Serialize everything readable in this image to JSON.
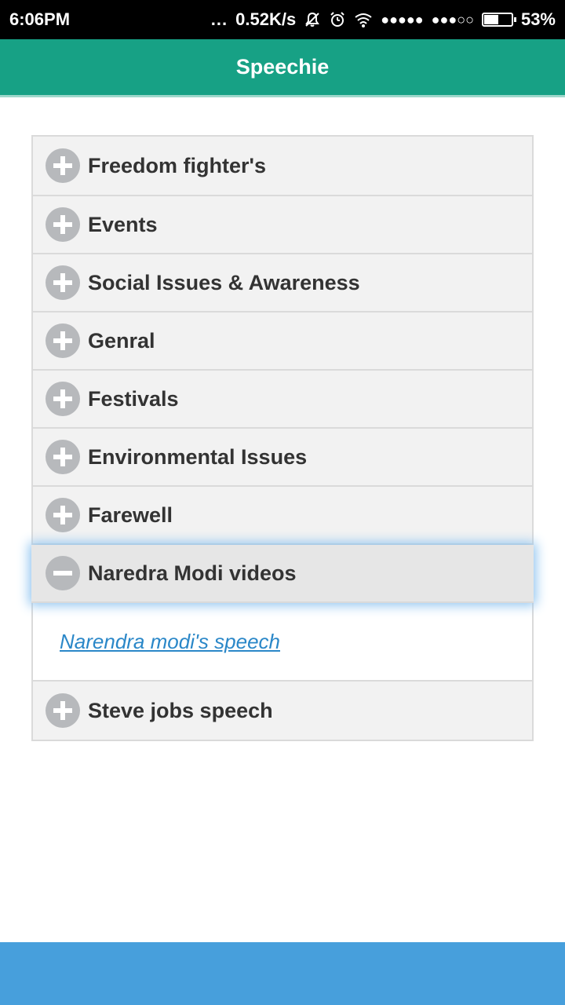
{
  "status_bar": {
    "time": "6:06PM",
    "more_dots": "...",
    "net_speed": "0.52K/s",
    "signal1": "●●●●●",
    "signal2": "●●●○○",
    "battery_percent": "53%",
    "battery_level": 0.53,
    "icons": [
      "mute-bell-icon",
      "alarm-icon",
      "wifi-icon"
    ]
  },
  "header": {
    "title": "Speechie",
    "color": "#17a185"
  },
  "accordion": {
    "items": [
      {
        "label": "Freedom fighter's",
        "expanded": false
      },
      {
        "label": "Events",
        "expanded": false
      },
      {
        "label": "Social Issues & Awareness",
        "expanded": false
      },
      {
        "label": "Genral",
        "expanded": false
      },
      {
        "label": "Festivals",
        "expanded": false
      },
      {
        "label": "Environmental Issues",
        "expanded": false
      },
      {
        "label": "Farewell",
        "expanded": false
      },
      {
        "label": "Naredra Modi videos",
        "expanded": true,
        "content_link": "Narendra modi's speech"
      },
      {
        "label": "Steve jobs speech",
        "expanded": false
      }
    ]
  },
  "bottom_bar": {
    "color": "#479fdc"
  }
}
